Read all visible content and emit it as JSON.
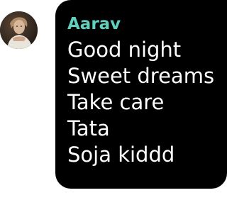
{
  "message": {
    "sender_name": "Aarav",
    "sender_color": "#5fd0bd",
    "bubble_color": "#000000",
    "text_color": "#ffffff",
    "lines": [
      "Good night",
      "Sweet dreams",
      "Take care",
      "Tata",
      "Soja kiddd"
    ]
  },
  "avatar": {
    "icon": "profile-photo"
  }
}
